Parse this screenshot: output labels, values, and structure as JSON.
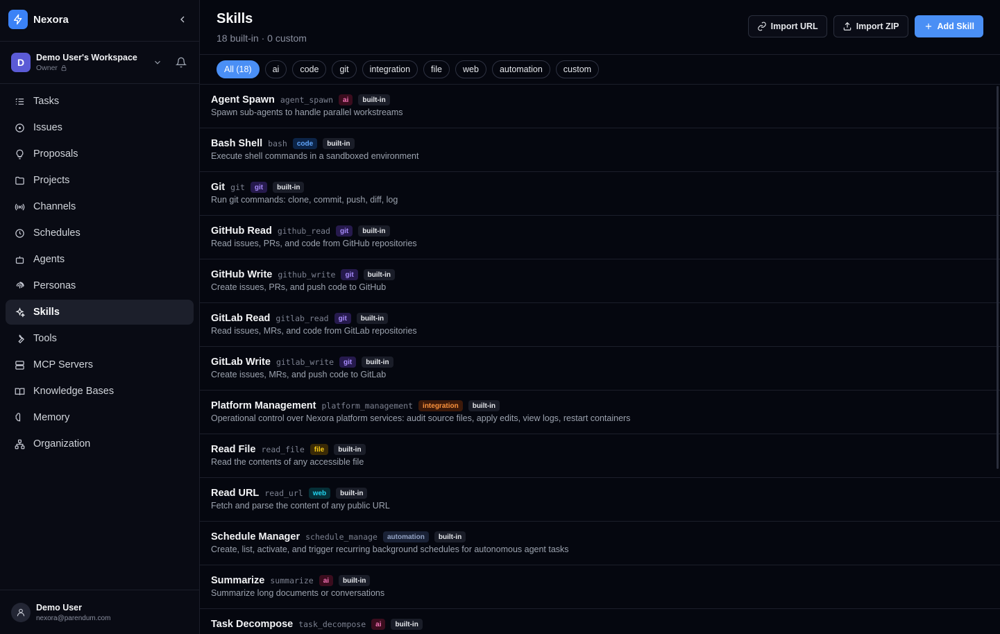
{
  "brand": {
    "name": "Nexora",
    "accent": "#3b82f6"
  },
  "workspace": {
    "name": "Demo User's Workspace",
    "role": "Owner",
    "initial": "D"
  },
  "nav": [
    {
      "label": "Tasks",
      "icon": "tasks-icon"
    },
    {
      "label": "Issues",
      "icon": "issues-icon"
    },
    {
      "label": "Proposals",
      "icon": "lightbulb-icon"
    },
    {
      "label": "Projects",
      "icon": "folder-icon"
    },
    {
      "label": "Channels",
      "icon": "broadcast-icon"
    },
    {
      "label": "Schedules",
      "icon": "clock-icon"
    },
    {
      "label": "Agents",
      "icon": "bot-icon"
    },
    {
      "label": "Personas",
      "icon": "fingerprint-icon"
    },
    {
      "label": "Skills",
      "icon": "sparkles-icon",
      "active": true
    },
    {
      "label": "Tools",
      "icon": "wrench-icon"
    },
    {
      "label": "MCP Servers",
      "icon": "server-icon"
    },
    {
      "label": "Knowledge Bases",
      "icon": "book-icon"
    },
    {
      "label": "Memory",
      "icon": "brain-icon"
    },
    {
      "label": "Organization",
      "icon": "network-icon"
    }
  ],
  "user": {
    "name": "Demo User",
    "email": "nexora@parendum.com"
  },
  "header": {
    "title": "Skills",
    "subtitle": "18 built-in · 0 custom",
    "import_url": "Import URL",
    "import_zip": "Import ZIP",
    "add_skill": "Add Skill"
  },
  "filters": [
    "All (18)",
    "ai",
    "code",
    "git",
    "integration",
    "file",
    "web",
    "automation",
    "custom"
  ],
  "tag_colors": {
    "ai": {
      "bg": "#3b0d1e",
      "fg": "#f472b6"
    },
    "code": {
      "bg": "#0c2447",
      "fg": "#60a5fa"
    },
    "git": {
      "bg": "#261a4d",
      "fg": "#a78bfa"
    },
    "integration": {
      "bg": "#3d1a0a",
      "fg": "#fb923c"
    },
    "file": {
      "bg": "#3a2a06",
      "fg": "#facc15"
    },
    "web": {
      "bg": "#062f37",
      "fg": "#22d3ee"
    },
    "automation": {
      "bg": "#1a2236",
      "fg": "#93a3c4"
    }
  },
  "skills": [
    {
      "name": "Agent Spawn",
      "id": "agent_spawn",
      "tag": "ai",
      "badge": "built-in",
      "desc": "Spawn sub-agents to handle parallel workstreams"
    },
    {
      "name": "Bash Shell",
      "id": "bash",
      "tag": "code",
      "badge": "built-in",
      "desc": "Execute shell commands in a sandboxed environment"
    },
    {
      "name": "Git",
      "id": "git",
      "tag": "git",
      "badge": "built-in",
      "desc": "Run git commands: clone, commit, push, diff, log"
    },
    {
      "name": "GitHub Read",
      "id": "github_read",
      "tag": "git",
      "badge": "built-in",
      "desc": "Read issues, PRs, and code from GitHub repositories"
    },
    {
      "name": "GitHub Write",
      "id": "github_write",
      "tag": "git",
      "badge": "built-in",
      "desc": "Create issues, PRs, and push code to GitHub"
    },
    {
      "name": "GitLab Read",
      "id": "gitlab_read",
      "tag": "git",
      "badge": "built-in",
      "desc": "Read issues, MRs, and code from GitLab repositories"
    },
    {
      "name": "GitLab Write",
      "id": "gitlab_write",
      "tag": "git",
      "badge": "built-in",
      "desc": "Create issues, MRs, and push code to GitLab"
    },
    {
      "name": "Platform Management",
      "id": "platform_management",
      "tag": "integration",
      "badge": "built-in",
      "desc": "Operational control over Nexora platform services: audit source files, apply edits, view logs, restart containers"
    },
    {
      "name": "Read File",
      "id": "read_file",
      "tag": "file",
      "badge": "built-in",
      "desc": "Read the contents of any accessible file"
    },
    {
      "name": "Read URL",
      "id": "read_url",
      "tag": "web",
      "badge": "built-in",
      "desc": "Fetch and parse the content of any public URL"
    },
    {
      "name": "Schedule Manager",
      "id": "schedule_manage",
      "tag": "automation",
      "badge": "built-in",
      "desc": "Create, list, activate, and trigger recurring background schedules for autonomous agent tasks"
    },
    {
      "name": "Summarize",
      "id": "summarize",
      "tag": "ai",
      "badge": "built-in",
      "desc": "Summarize long documents or conversations"
    },
    {
      "name": "Task Decompose",
      "id": "task_decompose",
      "tag": "ai",
      "badge": "built-in",
      "desc": ""
    }
  ]
}
